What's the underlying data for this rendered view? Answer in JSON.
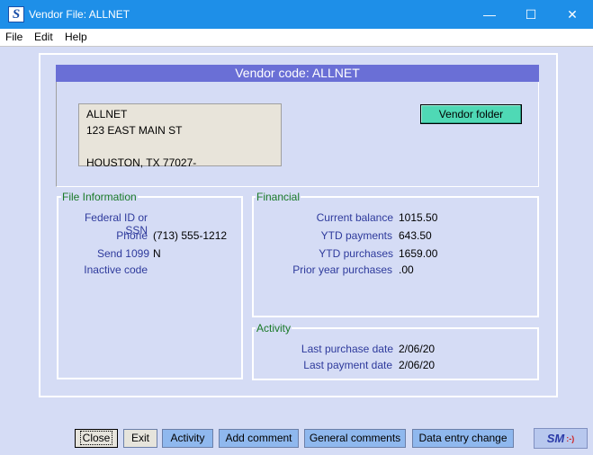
{
  "window": {
    "title": "Vendor File: ALLNET",
    "app_icon": "S",
    "minimize_icon": "—",
    "maximize_icon": "☐",
    "close_icon": "✕"
  },
  "menu": {
    "file": "File",
    "edit": "Edit",
    "help": "Help"
  },
  "header": {
    "vendor_code_text": "Vendor code:  ALLNET"
  },
  "address": {
    "line1": "ALLNET",
    "line2": "123 EAST MAIN ST",
    "line3": "",
    "line4": "HOUSTON, TX  77027-"
  },
  "vendor_folder_label": "Vendor folder",
  "file_information": {
    "title": "File Information",
    "federal_id_label": "Federal ID or SSN",
    "federal_id_value": "",
    "phone_label": "Phone",
    "phone_value": "(713) 555-1212",
    "send1099_label": "Send 1099",
    "send1099_value": "N",
    "inactive_label": "Inactive code",
    "inactive_value": ""
  },
  "financial": {
    "title": "Financial",
    "current_balance_label": "Current balance",
    "current_balance_value": "1015.50",
    "ytd_payments_label": "YTD payments",
    "ytd_payments_value": "643.50",
    "ytd_purchases_label": "YTD purchases",
    "ytd_purchases_value": "1659.00",
    "prior_year_label": "Prior year purchases",
    "prior_year_value": ".00"
  },
  "activity": {
    "title": "Activity",
    "last_purchase_label": "Last purchase date",
    "last_purchase_value": "2/06/20",
    "last_payment_label": "Last payment date",
    "last_payment_value": "2/06/20"
  },
  "buttons": {
    "close": "Close",
    "exit": "Exit",
    "activity": "Activity",
    "add_comment": "Add comment",
    "general_comments": "General comments",
    "data_entry_change": "Data entry change"
  },
  "logo": {
    "text": "SM",
    "smile": ":-)"
  }
}
